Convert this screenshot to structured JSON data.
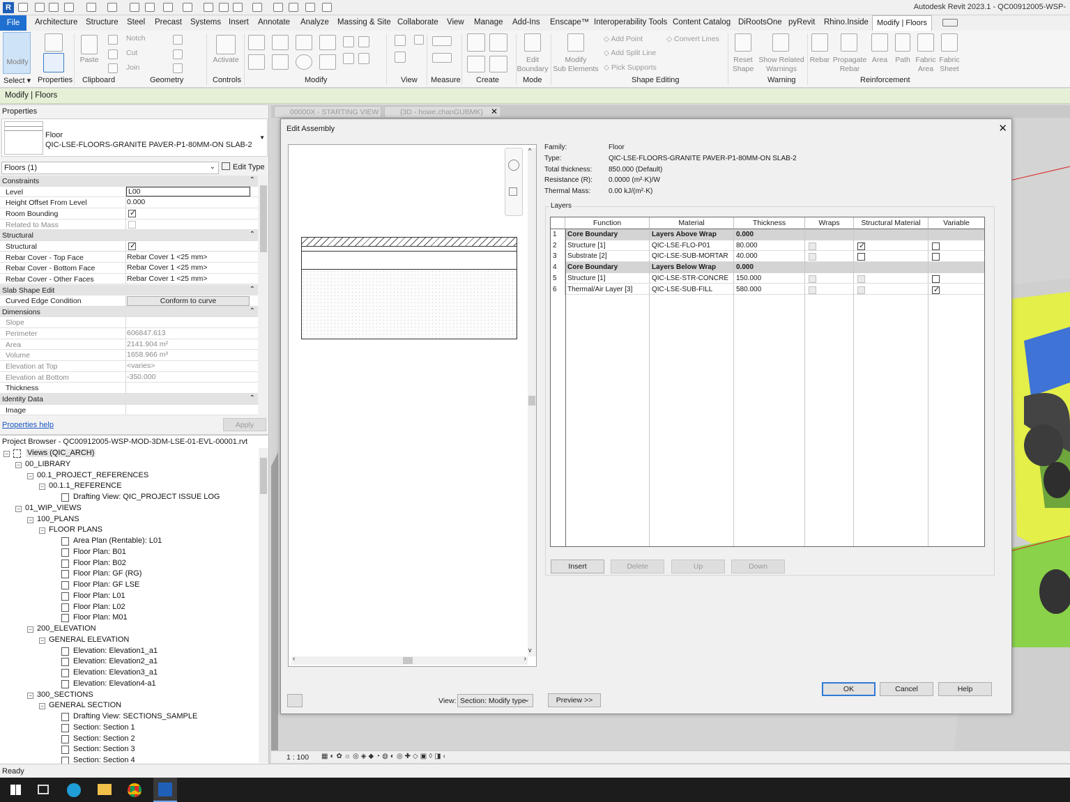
{
  "app": {
    "title": "Autodesk Revit 2023.1 - QC00912005-WSP-",
    "logo": "R"
  },
  "menu": {
    "file": "File",
    "tabs": [
      "Architecture",
      "Structure",
      "Steel",
      "Precast",
      "Systems",
      "Insert",
      "Annotate",
      "Analyze",
      "Massing & Site",
      "Collaborate",
      "View",
      "Manage",
      "Add-Ins",
      "Enscape™",
      "Interoperability Tools",
      "Content Catalog",
      "DiRootsOne",
      "pyRevit",
      "Rhino.Inside",
      "Modify | Floors"
    ]
  },
  "ribbon": {
    "modify": "Modify",
    "paste": "Paste",
    "properties": "Properties",
    "notch": "Notch",
    "cut": "Cut",
    "join": "Join",
    "activate": "Activate",
    "edit_boundary_1": "Edit",
    "edit_boundary_2": "Boundary",
    "modify_sub_1": "Modify",
    "modify_sub_2": "Sub Elements",
    "add_point": "Add Point",
    "add_split_line": "Add Split Line",
    "pick_supports": "Pick Supports",
    "convert_lines": "Convert Lines",
    "reset_shape_1": "Reset",
    "reset_shape_2": "Shape",
    "show_related_1": "Show Related",
    "show_related_2": "Warnings",
    "rebar": "Rebar",
    "propagate_1": "Propagate",
    "propagate_2": "Rebar",
    "area": "Area",
    "path": "Path",
    "fabric_area_1": "Fabric",
    "fabric_area_2": "Area",
    "fabric_sheet_1": "Fabric",
    "fabric_sheet_2": "Sheet",
    "groups": [
      "Select ▾",
      "Properties",
      "Clipboard",
      "Geometry",
      "Controls",
      "Modify",
      "View",
      "Measure",
      "Create",
      "Mode",
      "Shape Editing",
      "Warning",
      "Reinforcement"
    ]
  },
  "context_bar": "Modify | Floors",
  "properties": {
    "title": "Properties",
    "family": "Floor",
    "type": "QIC-LSE-FLOORS-GRANITE PAVER-P1-80MM-ON SLAB-2",
    "filter": "Floors (1)",
    "edit_type": "Edit Type",
    "rows": [
      {
        "k": "Constraints",
        "cat": true
      },
      {
        "k": "Level",
        "v": "L00",
        "input": true
      },
      {
        "k": "Height Offset From Level",
        "v": "0.000"
      },
      {
        "k": "Room Bounding",
        "cb": true
      },
      {
        "k": "Related to Mass",
        "cbdis": true,
        "dis": true
      },
      {
        "k": "Structural",
        "cat": true
      },
      {
        "k": "Structural",
        "cb": true
      },
      {
        "k": "Rebar Cover - Top Face",
        "v": "Rebar Cover 1 <25 mm>"
      },
      {
        "k": "Rebar Cover - Bottom Face",
        "v": "Rebar Cover 1 <25 mm>"
      },
      {
        "k": "Rebar Cover - Other Faces",
        "v": "Rebar Cover 1 <25 mm>"
      },
      {
        "k": "Slab Shape Edit",
        "cat": true
      },
      {
        "k": "Curved Edge Condition",
        "v": "Conform to curve",
        "btn": true
      },
      {
        "k": "Dimensions",
        "cat": true
      },
      {
        "k": "Slope",
        "v": "",
        "dis": true
      },
      {
        "k": "Perimeter",
        "v": "606847.613",
        "dis": true
      },
      {
        "k": "Area",
        "v": "2141.904 m²",
        "dis": true
      },
      {
        "k": "Volume",
        "v": "1658.966 m³",
        "dis": true
      },
      {
        "k": "Elevation at Top",
        "v": "<varies>",
        "dis": true
      },
      {
        "k": "Elevation at Bottom",
        "v": "-350.000",
        "dis": true
      },
      {
        "k": "Thickness",
        "v": ""
      },
      {
        "k": "Identity Data",
        "cat": true
      },
      {
        "k": "Image",
        "v": ""
      }
    ],
    "help": "Properties help",
    "apply": "Apply"
  },
  "browser": {
    "title": "Project Browser - QC00912005-WSP-MOD-3DM-LSE-01-EVL-00001.rvt",
    "nodes": [
      {
        "d": 0,
        "t": "Views (QIC_ARCH)",
        "exp": "−",
        "root": true
      },
      {
        "d": 1,
        "t": "00_LIBRARY",
        "exp": "−"
      },
      {
        "d": 2,
        "t": "00.1_PROJECT_REFERENCES",
        "exp": "−"
      },
      {
        "d": 3,
        "t": "00.1.1_REFERENCE",
        "exp": "−"
      },
      {
        "d": 4,
        "t": "Drafting View: QIC_PROJECT ISSUE LOG",
        "view": true
      },
      {
        "d": 1,
        "t": "01_WIP_VIEWS",
        "exp": "−"
      },
      {
        "d": 2,
        "t": "100_PLANS",
        "exp": "−"
      },
      {
        "d": 3,
        "t": "FLOOR PLANS",
        "exp": "−"
      },
      {
        "d": 4,
        "t": "Area Plan (Rentable): L01",
        "view": true
      },
      {
        "d": 4,
        "t": "Floor Plan: B01",
        "view": true
      },
      {
        "d": 4,
        "t": "Floor Plan: B02",
        "view": true
      },
      {
        "d": 4,
        "t": "Floor Plan: GF (RG)",
        "view": true
      },
      {
        "d": 4,
        "t": "Floor Plan: GF LSE",
        "view": true
      },
      {
        "d": 4,
        "t": "Floor Plan: L01",
        "view": true
      },
      {
        "d": 4,
        "t": "Floor Plan: L02",
        "view": true
      },
      {
        "d": 4,
        "t": "Floor Plan: M01",
        "view": true
      },
      {
        "d": 2,
        "t": "200_ELEVATION",
        "exp": "−"
      },
      {
        "d": 3,
        "t": "GENERAL ELEVATION",
        "exp": "−"
      },
      {
        "d": 4,
        "t": "Elevation: Elevation1_a1",
        "view": true
      },
      {
        "d": 4,
        "t": "Elevation: Elevation2_a1",
        "view": true
      },
      {
        "d": 4,
        "t": "Elevation: Elevation3_a1",
        "view": true
      },
      {
        "d": 4,
        "t": "Elevation: Elevation4-a1",
        "view": true
      },
      {
        "d": 2,
        "t": "300_SECTIONS",
        "exp": "−"
      },
      {
        "d": 3,
        "t": "GENERAL SECTION",
        "exp": "−"
      },
      {
        "d": 4,
        "t": "Drafting View: SECTIONS_SAMPLE",
        "view": true
      },
      {
        "d": 4,
        "t": "Section: Section 1",
        "view": true
      },
      {
        "d": 4,
        "t": "Section: Section 2",
        "view": true
      },
      {
        "d": 4,
        "t": "Section: Section 3",
        "view": true
      },
      {
        "d": 4,
        "t": "Section: Section 4",
        "view": true
      }
    ]
  },
  "view_tabs": [
    "00000X - STARTING VIEW",
    "{3D - howe.chanGUBMK}"
  ],
  "view_scale": "1 : 100",
  "dialog": {
    "title": "Edit Assembly",
    "family_label": "Family:",
    "family": "Floor",
    "type_label": "Type:",
    "type": "QIC-LSE-FLOORS-GRANITE PAVER-P1-80MM-ON SLAB-2",
    "thickness_label": "Total thickness:",
    "thickness": "850.000 (Default)",
    "resistance_label": "Resistance (R):",
    "resistance": "0.0000 (m²·K)/W",
    "mass_label": "Thermal Mass:",
    "mass": "0.00 kJ/(m²·K)",
    "layers_label": "Layers",
    "columns": [
      "Function",
      "Material",
      "Thickness",
      "Wraps",
      "Structural Material",
      "Variable"
    ],
    "rows": [
      {
        "n": "1",
        "f": "Core Boundary",
        "m": "Layers Above Wrap",
        "t": "0.000",
        "core": true
      },
      {
        "n": "2",
        "f": "Structure [1]",
        "m": "QIC-LSE-FLO-P01",
        "t": "80.000",
        "wraps": "dim",
        "struct": "on",
        "var": "off"
      },
      {
        "n": "3",
        "f": "Substrate [2]",
        "m": "QIC-LSE-SUB-MORTAR",
        "t": "40.000",
        "wraps": "dim",
        "struct": "off",
        "var": "off"
      },
      {
        "n": "4",
        "f": "Core Boundary",
        "m": "Layers Below Wrap",
        "t": "0.000",
        "core": true
      },
      {
        "n": "5",
        "f": "Structure [1]",
        "m": "QIC-LSE-STR-CONCRE",
        "t": "150.000",
        "wraps": "dim",
        "struct": "dim",
        "var": "off"
      },
      {
        "n": "6",
        "f": "Thermal/Air Layer [3]",
        "m": "QIC-LSE-SUB-FILL",
        "t": "580.000",
        "wraps": "dim",
        "struct": "dim",
        "var": "on"
      }
    ],
    "insert": "Insert",
    "delete": "Delete",
    "up": "Up",
    "down": "Down",
    "view_label": "View:",
    "view_value": "Section: Modify type",
    "preview": "Preview >>",
    "ok": "OK",
    "cancel": "Cancel",
    "help": "Help"
  },
  "status": "Ready"
}
